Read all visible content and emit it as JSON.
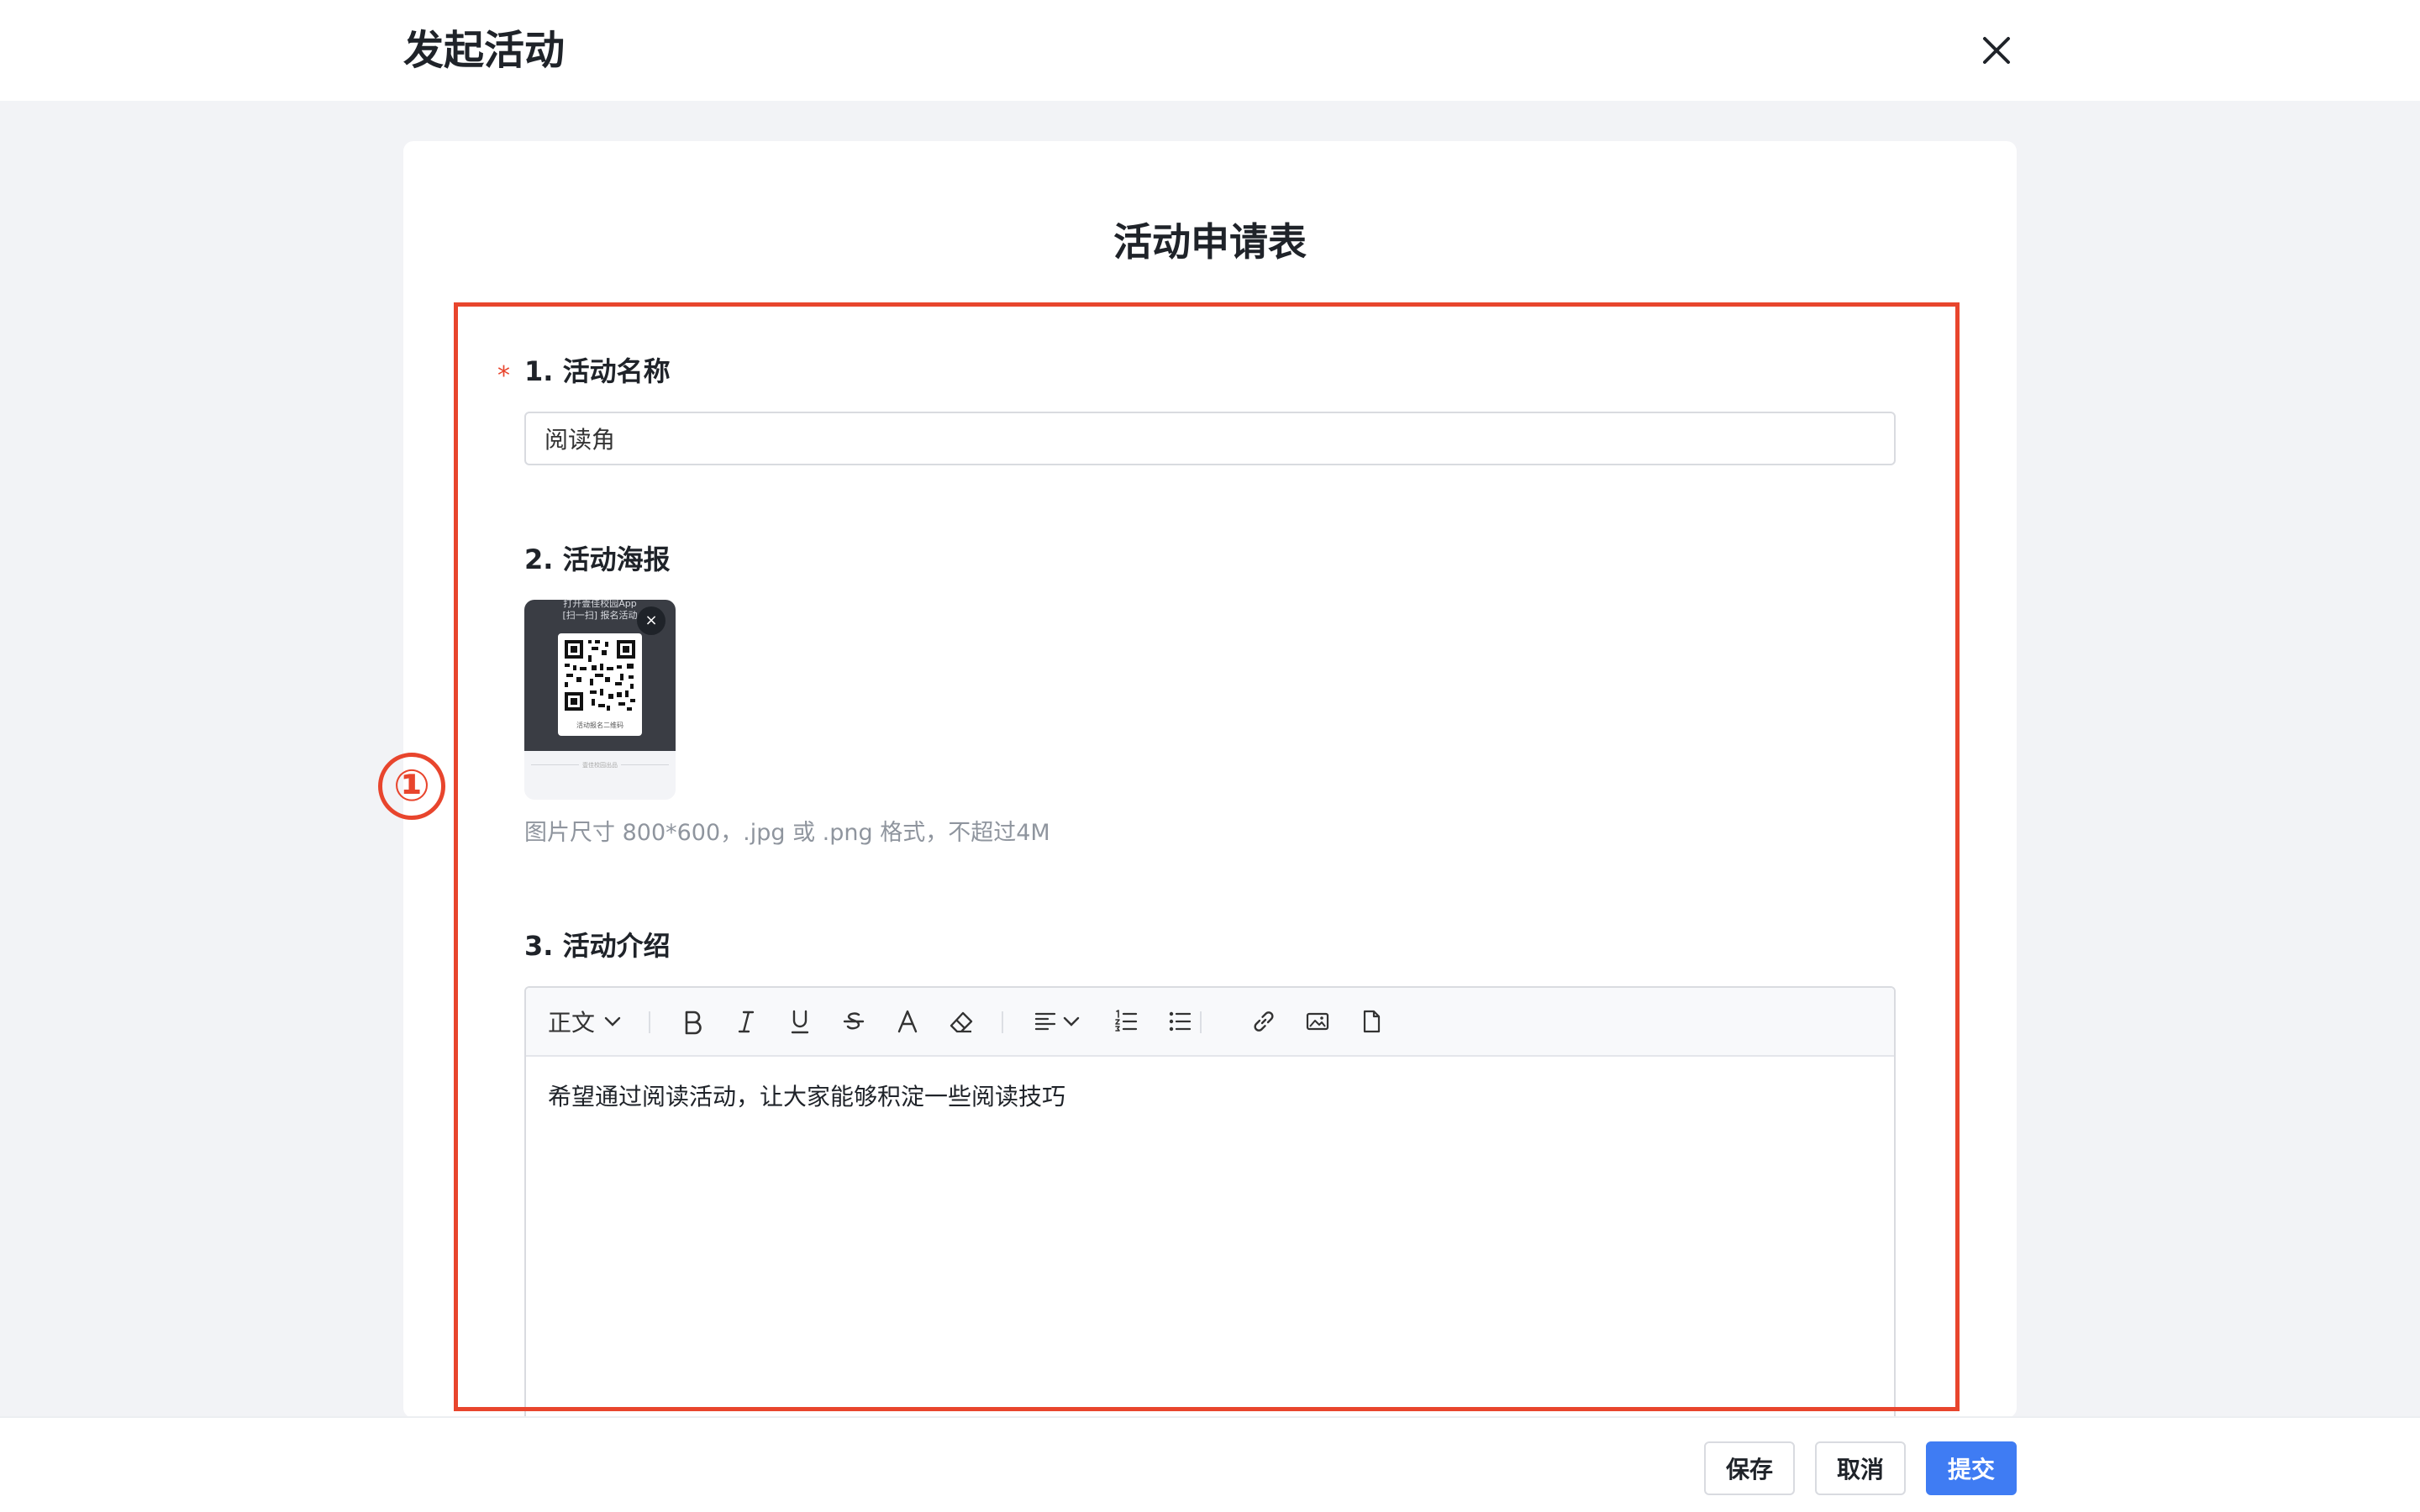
{
  "header": {
    "title": "发起活动"
  },
  "form": {
    "title": "活动申请表",
    "step_marker": "①",
    "field1": {
      "label": "1. 活动名称",
      "required_mark": "*",
      "value": "阅读角"
    },
    "field2": {
      "label": "2. 活动海报",
      "poster": {
        "caption_line1": "打开壹佳校园App",
        "caption_line2": "[扫一扫] 报名活动",
        "qr_caption": "活动报名二维码",
        "footer_text": "壹佳校园出品"
      },
      "remove_glyph": "×",
      "hint": "图片尺寸 800*600，.jpg 或 .png 格式，不超过4M"
    },
    "field3": {
      "label": "3. 活动介绍",
      "toolbar": {
        "style_label": "正文"
      },
      "content": "希望通过阅读活动，让大家能够积淀一些阅读技巧"
    }
  },
  "footer": {
    "save": "保存",
    "cancel": "取消",
    "submit": "提交"
  },
  "colors": {
    "accent": "#3f7cf3",
    "highlight": "#e8452d",
    "background": "#f2f3f6"
  }
}
